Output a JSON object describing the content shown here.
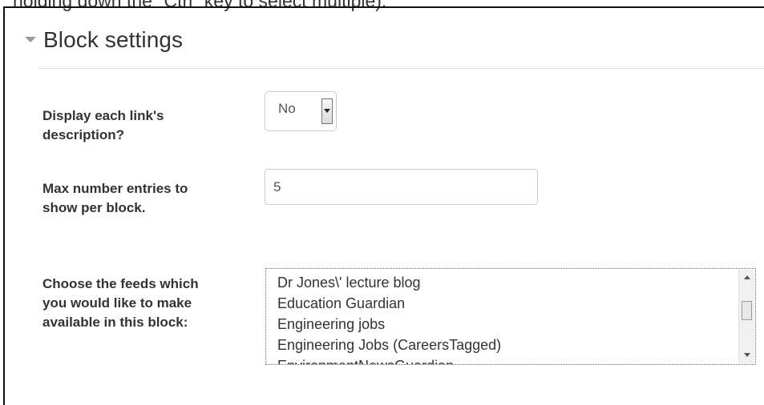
{
  "top_partial_text": "holding down the \"Ctrl\" key to select multiple).",
  "section": {
    "title": "Block settings",
    "collapse_icon": "triangle-down-icon"
  },
  "fields": {
    "display_description": {
      "label": "Display each link's description?",
      "value": "No",
      "arrow_icon": "dropdown-arrow-icon"
    },
    "max_entries": {
      "label": "Max number entries to show per block.",
      "value": "5"
    },
    "feeds": {
      "label": "Choose the feeds which you would like to make available in this block:",
      "items": [
        "Dr Jones\\' lecture blog",
        "Education Guardian",
        "Engineering jobs",
        "Engineering Jobs (CareersTagged)",
        "EnvironmentNewsGuardian"
      ],
      "scroll_up_icon": "scroll-up-arrow-icon",
      "scroll_down_icon": "scroll-down-arrow-icon"
    }
  },
  "colors": {
    "text": "#333333",
    "input_border": "#cccccc",
    "frame": "#111111",
    "rule": "#e5e5e5"
  }
}
